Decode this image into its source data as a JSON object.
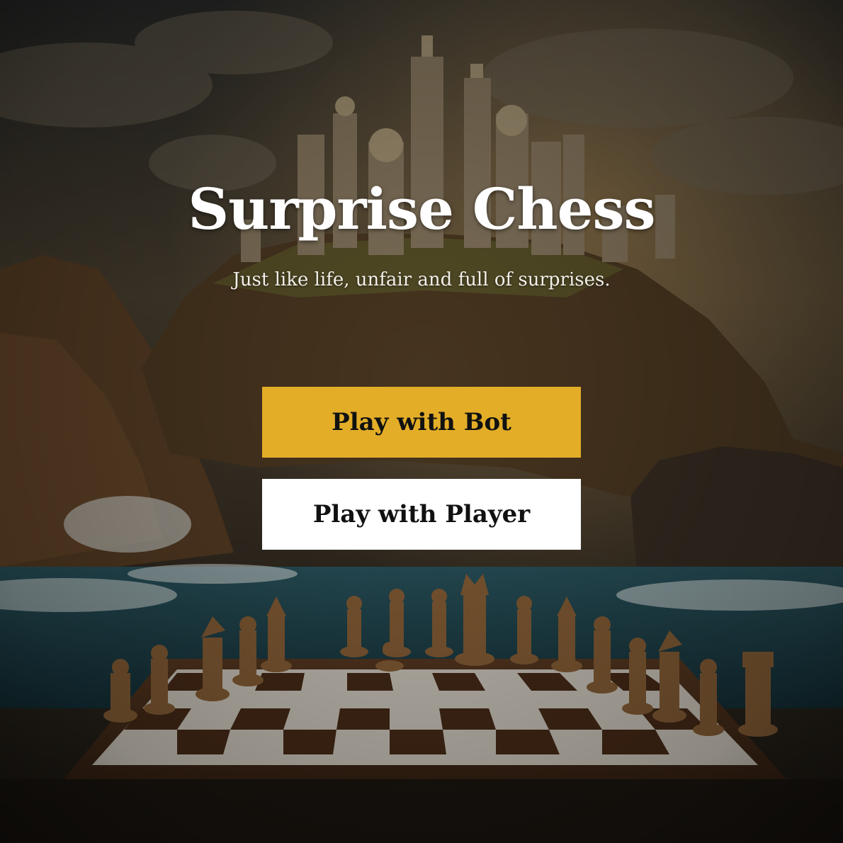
{
  "hero": {
    "title": "Surprise Chess",
    "subtitle": "Just like life, unfair and full of surprises."
  },
  "actions": {
    "bot_label": "Play with Bot",
    "player_label": "Play with Player"
  },
  "colors": {
    "accent": "#e3ad28",
    "secondary_button": "#ffffff",
    "title_text": "#ffffff"
  }
}
